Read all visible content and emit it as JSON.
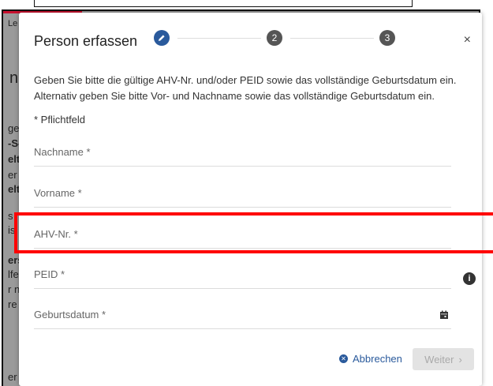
{
  "dialog": {
    "title": "Person erfassen",
    "steps": [
      "2",
      "3"
    ],
    "close_label": "×",
    "description_line1": "Geben Sie bitte die gültige AHV-Nr. und/oder PEID sowie das vollständige Geburtsdatum ein.",
    "description_line2": "Alternativ geben Sie bitte Vor- und Nachname sowie das vollständige Geburtsdatum ein.",
    "required_note": "* Pflichtfeld"
  },
  "fields": {
    "nachname": "Nachname *",
    "vorname": "Vorname *",
    "ahv": "AHV-Nr. *",
    "peid": "PEID *",
    "geburtsdatum": "Geburtsdatum *"
  },
  "icons": {
    "edit": "pencil-icon",
    "info": "i",
    "calendar": "calendar-icon"
  },
  "actions": {
    "cancel_label": "Abbrechen",
    "next_label": "Weiter",
    "next_chevron": "›"
  },
  "background": {
    "fragments": [
      "Le",
      "n",
      "ge",
      "-S-",
      "elt",
      "er",
      "elt",
      "s",
      "is",
      "ers",
      "lfe",
      "r n",
      "re",
      "er"
    ]
  },
  "colors": {
    "accent": "#2a5a9c",
    "highlight": "#ff0000",
    "brand_red": "#c8102e"
  }
}
